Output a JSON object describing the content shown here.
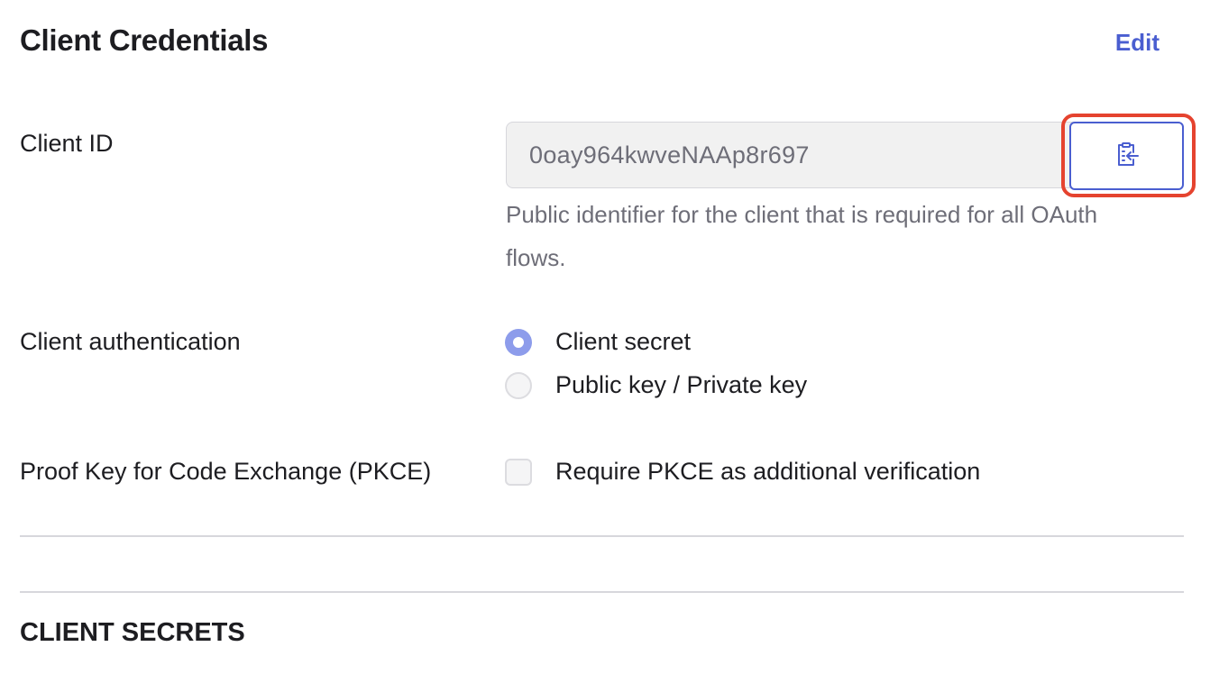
{
  "header": {
    "title": "Client Credentials",
    "edit_label": "Edit"
  },
  "client_id": {
    "label": "Client ID",
    "value": "0oay964kwveNAAp8r697",
    "copy_icon": "clipboard-copy-icon",
    "help_text": "Public identifier for the client that is required for all OAuth flows."
  },
  "client_authentication": {
    "label": "Client authentication",
    "options": [
      {
        "label": "Client secret",
        "checked": true
      },
      {
        "label": "Public key / Private key",
        "checked": false
      }
    ]
  },
  "pkce": {
    "label": "Proof Key for Code Exchange (PKCE)",
    "checkbox_label": "Require PKCE as additional verification",
    "checked": false
  },
  "client_secrets": {
    "title": "CLIENT SECRETS"
  },
  "colors": {
    "accent": "#4a5ed0",
    "radio_checked": "#8d9ceb",
    "highlight": "#e5432f"
  }
}
